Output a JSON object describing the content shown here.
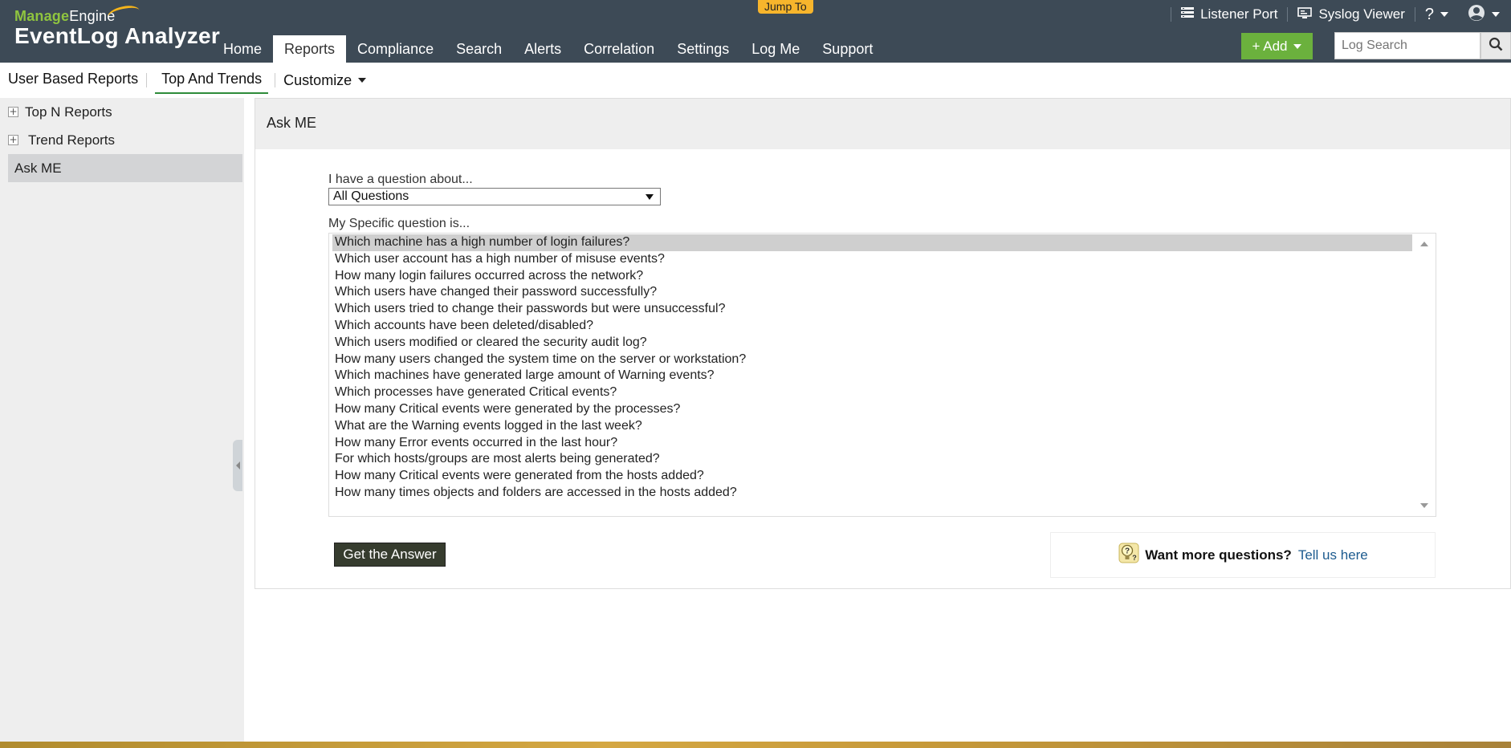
{
  "header": {
    "logo_brand_a": "Manage",
    "logo_brand_b": "Engine",
    "logo_product": "EventLog Analyzer",
    "jump_to": "Jump To",
    "nav": [
      {
        "label": "Home"
      },
      {
        "label": "Reports",
        "active": true
      },
      {
        "label": "Compliance"
      },
      {
        "label": "Search"
      },
      {
        "label": "Alerts"
      },
      {
        "label": "Correlation"
      },
      {
        "label": "Settings"
      },
      {
        "label": "Log Me"
      },
      {
        "label": "Support"
      }
    ],
    "listener_port": "Listener Port",
    "syslog_viewer": "Syslog Viewer",
    "help": "?",
    "add_label": "+ Add",
    "search_placeholder": "Log Search"
  },
  "subtabs": {
    "user_based": "User Based Reports",
    "top_trends": "Top And Trends",
    "customize": "Customize"
  },
  "sidebar": {
    "items": [
      {
        "label": "Top N Reports",
        "expand": "+"
      },
      {
        "label": "Trend Reports",
        "expand": "+"
      },
      {
        "label": "Ask ME",
        "active": true
      }
    ]
  },
  "main": {
    "title": "Ask ME",
    "question_about_label": "I have a question about...",
    "question_about_value": "All Questions",
    "specific_label": "My Specific question is...",
    "questions": [
      "Which machine has a high number of login failures?",
      "Which user account has a high number of misuse events?",
      "How many login failures occurred across the network?",
      "Which users have changed their password successfully?",
      "Which users tried to change their passwords but were unsuccessful?",
      "Which accounts have been deleted/disabled?",
      "Which users modified or cleared the security audit log?",
      "How many users changed the system time on the server or workstation?",
      "Which machines have generated large amount of Warning events?",
      "Which processes have generated Critical events?",
      "How many Critical events were generated by the processes?",
      "What are the Warning events logged in the last week?",
      "How many Error events occurred in the last hour?",
      "For which hosts/groups are most alerts being generated?",
      "How many Critical events were generated from the hosts added?",
      "How many times objects and folders are accessed in the hosts added?"
    ],
    "answer_button": "Get the Answer",
    "want_more": "Want more questions?",
    "tell_us": "Tell us here"
  },
  "colors": {
    "header_bg": "#3d4a56",
    "add_green": "#6bb13d",
    "active_tab_underline": "#2e8b3a",
    "jump_to_bg": "#f7b52c",
    "link": "#1d5b8f"
  },
  "icons": {
    "listener_port": "server-list-icon",
    "syslog_viewer": "monitor-icon",
    "user": "user-circle-icon",
    "search": "magnifier-icon",
    "want_more": "lightbulb-question-icon"
  }
}
